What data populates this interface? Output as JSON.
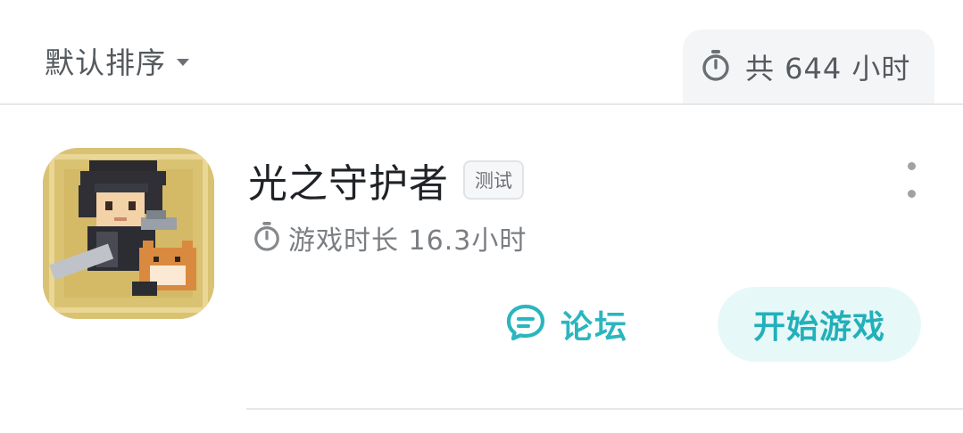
{
  "header": {
    "sort_label": "默认排序",
    "total_playtime": "共 644 小时"
  },
  "game": {
    "title": "光之守护者",
    "badge": "测试",
    "playtime": "游戏时长 16.3小时",
    "forum_label": "论坛",
    "start_label": "开始游戏"
  },
  "colors": {
    "accent": "#2bb6bf",
    "start_button_bg": "#e7f8f8",
    "chip_bg": "#f4f5f7",
    "divider": "#e5e7e9",
    "primary_text": "#1f2226",
    "secondary_text": "#7a7e82"
  },
  "icons": {
    "sort_caret": "caret-down-icon",
    "total_timer": "stopwatch-icon",
    "playtime_timer": "stopwatch-icon",
    "forum": "chat-bubble-icon",
    "more": "more-vertical-icon"
  }
}
